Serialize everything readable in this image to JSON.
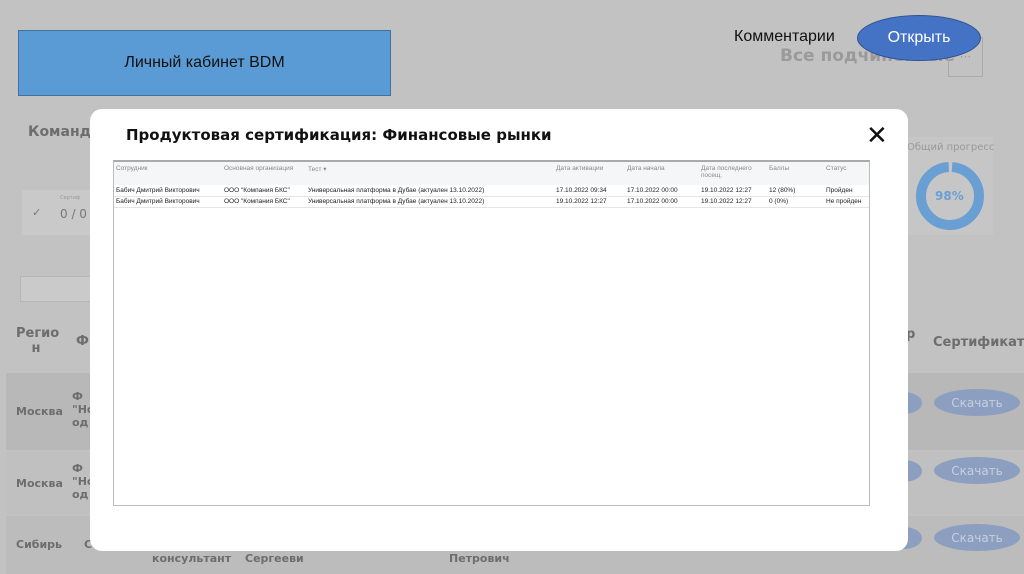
{
  "header": {
    "banner": "Личный кабинет BDM",
    "comments_label": "Комментарии",
    "open_button": "Открыть",
    "subordinates": "Все подчиненные",
    "more": "···"
  },
  "background": {
    "team": "Команда",
    "card_label": "Сертиф",
    "card_value": "0 / 0",
    "progress_label": "Общий прогресс",
    "progress_value": "98%",
    "progress_percent": 98,
    "columns": [
      "Регио н",
      "Ф",
      "р",
      "Сертификат"
    ],
    "rows": [
      {
        "region": "Москва",
        "f": "Ф \"Но од"
      },
      {
        "region": "Москва",
        "f": "Ф \"Но од"
      },
      {
        "region": "Сибирь",
        "f": "С"
      }
    ],
    "row3_extra": [
      "консультант",
      "Сергееви",
      "Петрович"
    ],
    "download": "Скачать"
  },
  "modal": {
    "title": "Продуктовая сертификация: Финансовые рынки",
    "columns": [
      "Сотрудник",
      "Основная организация",
      "Тест ▾",
      "Дата активации",
      "Дата начала",
      "Дата последнего посещ.",
      "Баллы",
      "Статус"
    ],
    "rows": [
      [
        "Бабич Дмитрий Викторович",
        "ООО \"Компания БКС\"",
        "Универсальная платформа в Дубае (актуален 13.10.2022)",
        "17.10.2022 09:34",
        "17.10.2022 00:00",
        "19.10.2022 12:27",
        "12 (80%)",
        "Пройден"
      ],
      [
        "Бабич Дмитрий Викторович",
        "ООО \"Компания БКС\"",
        "Универсальная платформа в Дубае (актуален 13.10.2022)",
        "19.10.2022 12:27",
        "17.10.2022 00:00",
        "19.10.2022 12:27",
        "0 (0%)",
        "Не пройден"
      ]
    ]
  },
  "colors": {
    "banner": "#5b9bd5",
    "open_button": "#4472c4",
    "progress": "#6a9fd4"
  }
}
